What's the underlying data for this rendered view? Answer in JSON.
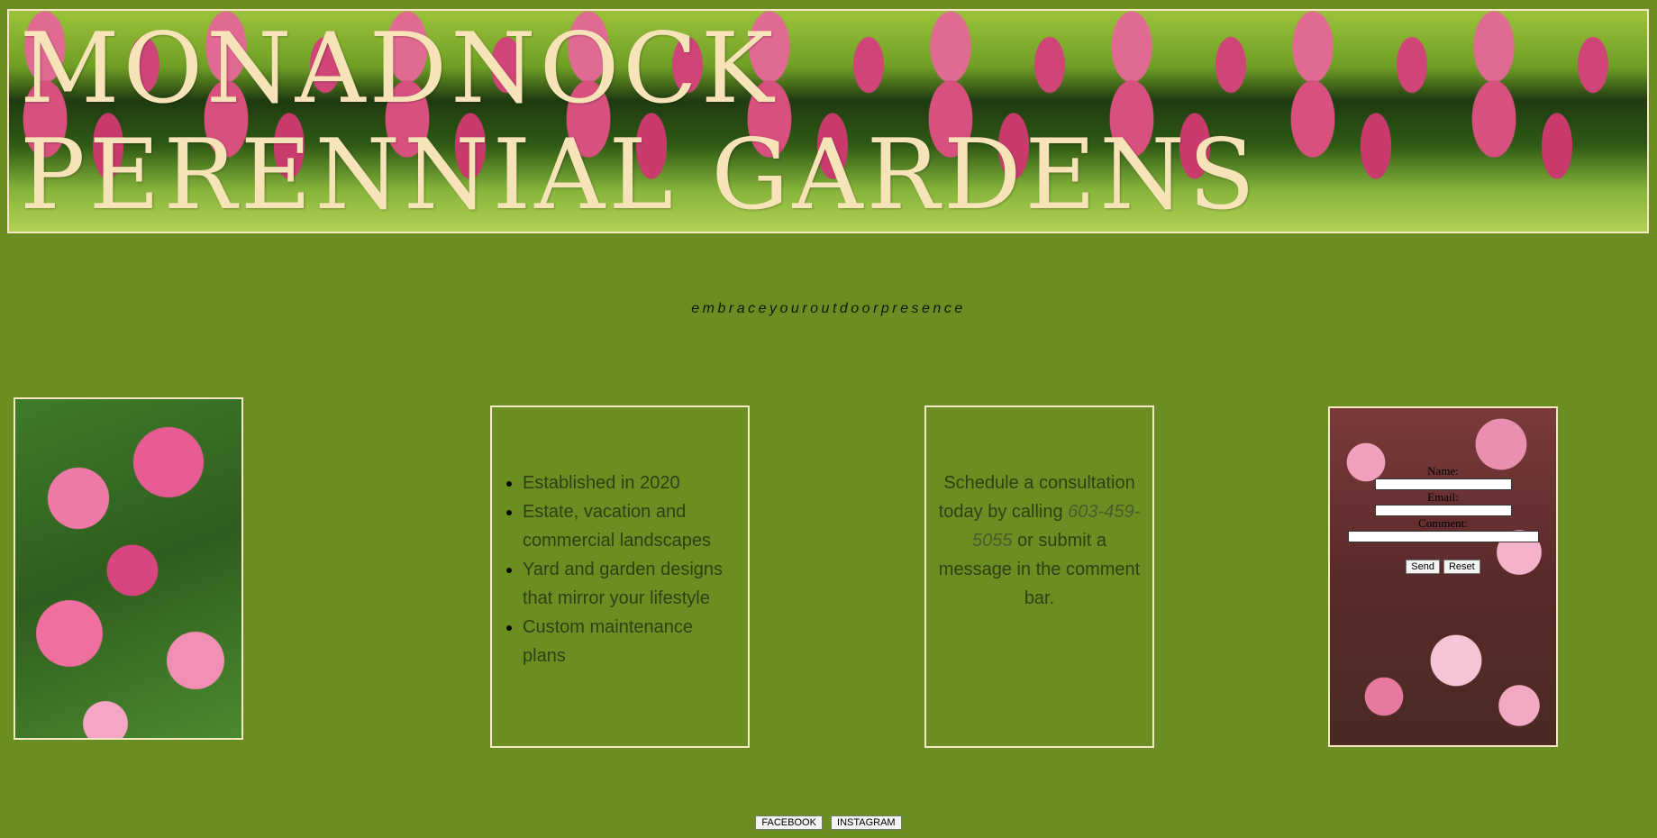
{
  "header": {
    "title": "Monadnock Perennial Gardens"
  },
  "tagline": "embraceyouroutdoorpresence",
  "features": [
    "Established in 2020",
    "Estate, vacation and commercial landscapes",
    "Yard and garden designs that mirror your lifestyle",
    "Custom maintenance plans"
  ],
  "contact": {
    "text_before": "Schedule a consultation today by calling ",
    "phone": "603-459-5055",
    "text_after": " or submit a message in the comment bar."
  },
  "form": {
    "name_label": "Name:",
    "email_label": "Email:",
    "comment_label": "Comment:",
    "send_label": "Send",
    "reset_label": "Reset"
  },
  "social": {
    "facebook_label": "FACEBOOK",
    "instagram_label": "INSTAGRAM"
  },
  "colors": {
    "background": "#6b8e23",
    "border": "#f5e6c4",
    "title": "#f7e3b8"
  }
}
